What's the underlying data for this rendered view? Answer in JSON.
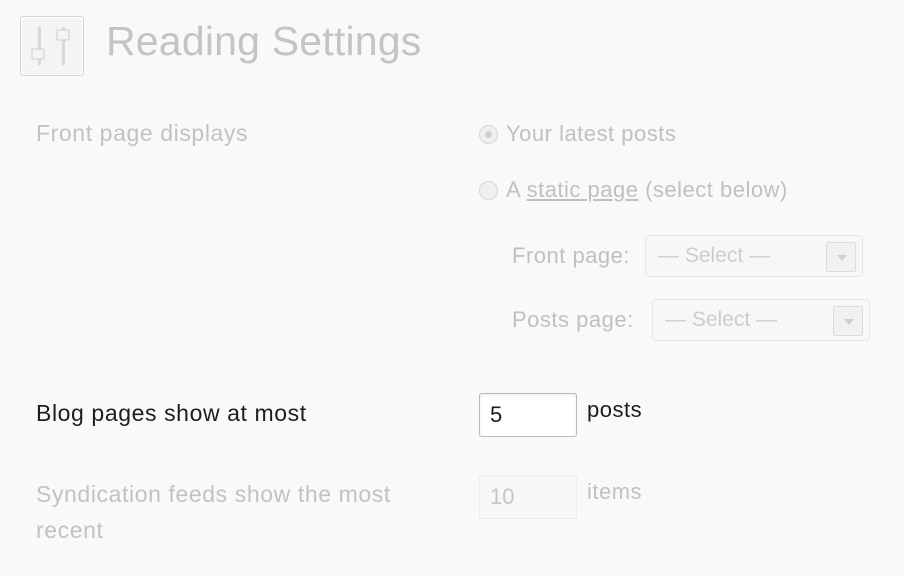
{
  "header": {
    "title": "Reading Settings",
    "icon": "settings-sliders-icon"
  },
  "front_page": {
    "label": "Front page displays",
    "options": [
      {
        "label": "Your latest posts",
        "checked": true
      },
      {
        "prefix": "A ",
        "link": "static page",
        "suffix": " (select below)",
        "checked": false
      }
    ],
    "front_page_select": {
      "label": "Front page:",
      "value": "— Select —"
    },
    "posts_page_select": {
      "label": "Posts page:",
      "value": "— Select —"
    }
  },
  "blog_pages": {
    "label": "Blog pages show at most",
    "value": "5",
    "unit": "posts"
  },
  "syndication": {
    "label": "Syndication feeds show the most recent",
    "value": "10",
    "unit": "items"
  },
  "colors": {
    "background": "#f9f9f9",
    "active_text": "#1d1d1d",
    "disabled_text": "#c2c2c2"
  }
}
